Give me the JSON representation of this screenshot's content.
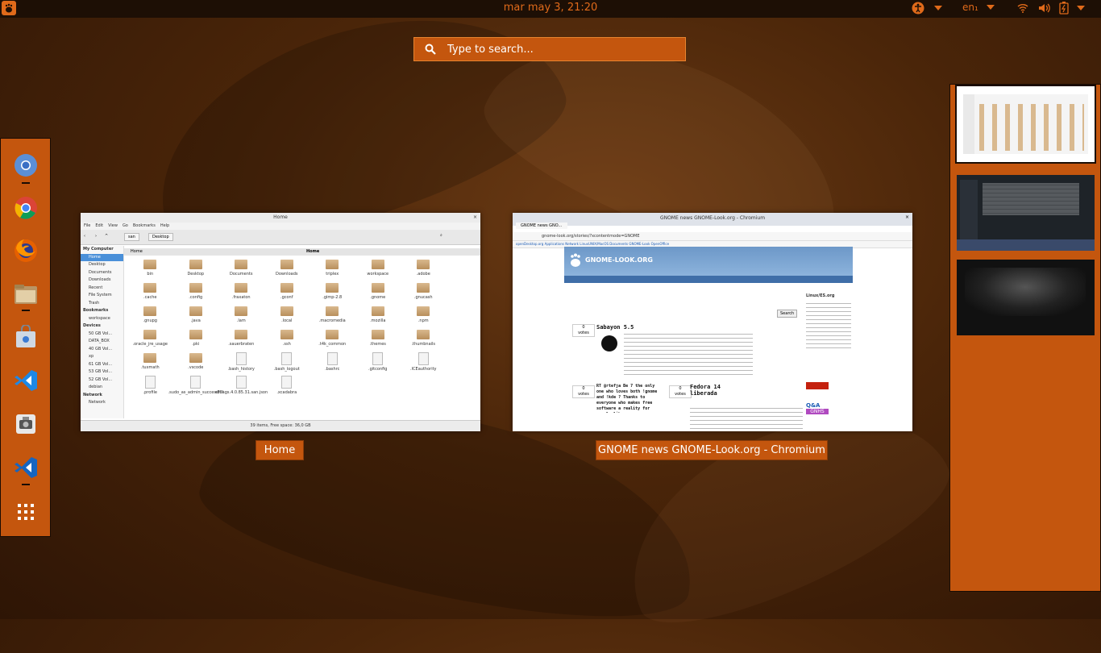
{
  "topbar": {
    "clock": "mar may  3, 21:20",
    "keyboard_layout": "en₁",
    "accessibility_icon": "accessibility-icon",
    "indicators": [
      "wifi-icon",
      "volume-icon",
      "battery-icon"
    ]
  },
  "search": {
    "placeholder": "Type to search..."
  },
  "dash": {
    "apps": [
      "chromium-icon",
      "chrome-icon",
      "firefox-icon",
      "files-icon",
      "software-center-icon",
      "vscode-icon",
      "screenshot-tool-icon",
      "vscode-insiders-icon",
      "show-apps-icon"
    ]
  },
  "windows": {
    "home": {
      "caption": "Home",
      "title": "Home",
      "menu": [
        "File",
        "Edit",
        "View",
        "Go",
        "Bookmarks",
        "Help"
      ],
      "path": [
        "san",
        "Desktop"
      ],
      "tabs": [
        "Home",
        "Home"
      ],
      "sidebar": {
        "my_computer": "My Computer",
        "places": [
          "Home",
          "Desktop",
          "Documents",
          "Downloads",
          "Recent",
          "File System",
          "Trash"
        ],
        "bookmarks": "Bookmarks",
        "bookmark_items": [
          "workspace"
        ],
        "devices": "Devices",
        "device_items": [
          "50 GB Vol...",
          "DATA_BOX",
          "40 GB Vol...",
          "xp",
          "61 GB Vol...",
          "53 GB Vol...",
          "52 GB Vol...",
          "debian"
        ],
        "network": "Network",
        "network_items": [
          "Network"
        ]
      },
      "items": [
        {
          "name": "bin",
          "kind": "folder"
        },
        {
          "name": "Desktop",
          "kind": "folder"
        },
        {
          "name": "Documents",
          "kind": "folder"
        },
        {
          "name": "Downloads",
          "kind": "folder"
        },
        {
          "name": "triplex",
          "kind": "folder"
        },
        {
          "name": "workspace",
          "kind": "folder"
        },
        {
          "name": ".adobe",
          "kind": "folder"
        },
        {
          "name": "",
          "kind": "none"
        },
        {
          "name": ".cache",
          "kind": "folder"
        },
        {
          "name": ".config",
          "kind": "folder"
        },
        {
          "name": ".fraxaton",
          "kind": "folder"
        },
        {
          "name": ".gconf",
          "kind": "folder"
        },
        {
          "name": ".gimp-2.8",
          "kind": "folder"
        },
        {
          "name": ".gnome",
          "kind": "folder"
        },
        {
          "name": ".gnucash",
          "kind": "folder"
        },
        {
          "name": "",
          "kind": "none"
        },
        {
          "name": ".gnupg",
          "kind": "folder"
        },
        {
          "name": ".java",
          "kind": "folder"
        },
        {
          "name": ".lam",
          "kind": "folder"
        },
        {
          "name": ".local",
          "kind": "folder"
        },
        {
          "name": ".macromedia",
          "kind": "folder"
        },
        {
          "name": ".mozilla",
          "kind": "folder"
        },
        {
          "name": ".npm",
          "kind": "folder"
        },
        {
          "name": "",
          "kind": "none"
        },
        {
          "name": ".oracle_jre_usage",
          "kind": "folder"
        },
        {
          "name": ".pki",
          "kind": "folder"
        },
        {
          "name": ".sauerbraten",
          "kind": "folder"
        },
        {
          "name": ".ssh",
          "kind": "folder"
        },
        {
          "name": ".t4k_common",
          "kind": "folder"
        },
        {
          "name": ".themes",
          "kind": "folder"
        },
        {
          "name": ".thumbnails",
          "kind": "folder"
        },
        {
          "name": "",
          "kind": "none"
        },
        {
          "name": ".tuxmath",
          "kind": "folder"
        },
        {
          "name": ".vscode",
          "kind": "folder"
        },
        {
          "name": ".bash_history",
          "kind": "file"
        },
        {
          "name": ".bash_logout",
          "kind": "file"
        },
        {
          "name": ".bashrc",
          "kind": "file"
        },
        {
          "name": ".gitconfig",
          "kind": "file"
        },
        {
          "name": ".ICEauthority",
          "kind": "file"
        },
        {
          "name": "",
          "kind": "none"
        },
        {
          "name": ".profile",
          "kind": "file"
        },
        {
          "name": ".sudo_as_admin_successful",
          "kind": "file"
        },
        {
          "name": "x8flags.4.0.85.31.san.json",
          "kind": "file"
        },
        {
          "name": ".xcadabra",
          "kind": "file"
        }
      ],
      "status": "39 items, Free space: 36,0 GB"
    },
    "chromium": {
      "caption": "GNOME news GNOME-Look.org - Chromium",
      "title": "GNOME news GNOME-Look.org - Chromium",
      "tab": "GNOME news GNO...",
      "url": "gnome-look.org/stories/?xcontentmode=GNOME",
      "bookmarks": "openDesktop.org   Applications   Network   LinuxUNIX/MacOS   Documents   GNOME-Look   OpenOffice",
      "logo": "GNOME-LOOK.ORG",
      "post1_title": "Sabayon 5.5",
      "post1_votes": "0",
      "post2_title": "RT @rtefja Be 7 the only one who loves both !gnome and !kde ? Thanks to everyone who makes free software a reality for people like me.",
      "post2_votes": "0",
      "post3_title": "Fedora 14 liberada",
      "post3_votes": "0",
      "votes_label": "votes",
      "search_button": "Search",
      "sidebar": [
        "Linux/ES.org",
        "Q&A",
        "GNHS"
      ]
    }
  },
  "workspaces": [
    "workspace-1",
    "workspace-2",
    "workspace-3"
  ]
}
